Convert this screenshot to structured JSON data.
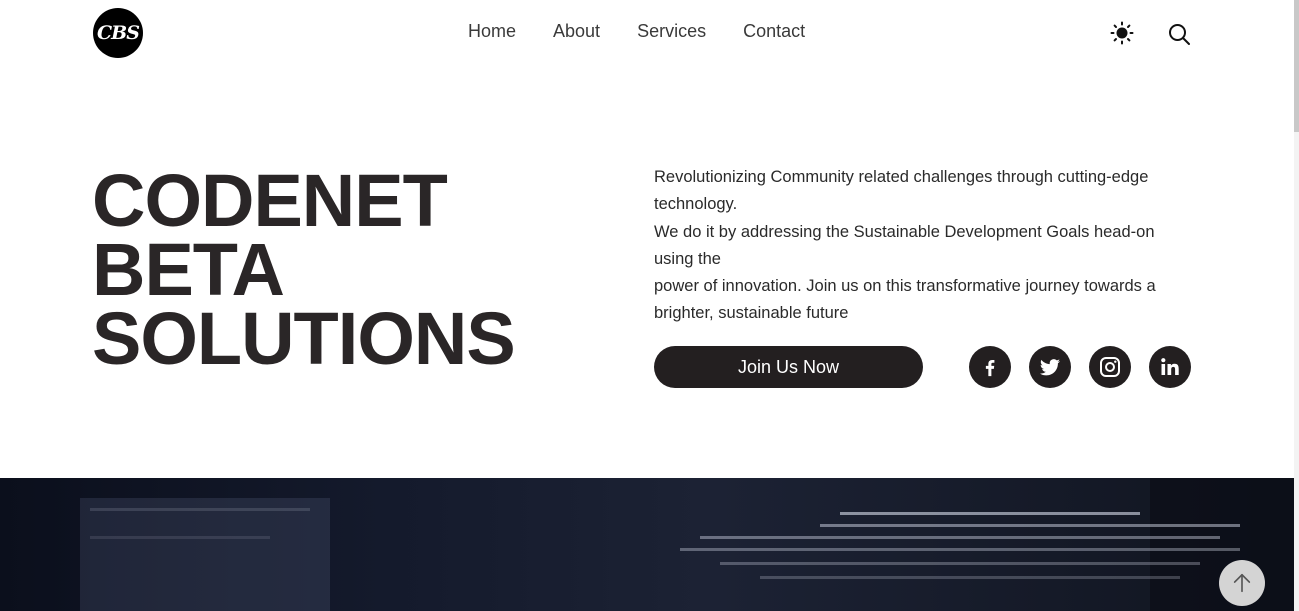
{
  "header": {
    "logo_text": "CBS",
    "nav": [
      "Home",
      "About",
      "Services",
      "Contact"
    ],
    "theme_icon": "sun-icon",
    "search_icon": "search-icon"
  },
  "hero": {
    "title_lines": [
      "CODENET",
      "BETA",
      "SOLUTIONS"
    ],
    "description_lines": [
      "Revolutionizing Community related challenges through cutting-edge technology.",
      "We do it by addressing the Sustainable Development Goals head-on using the",
      "power of innovation. Join us on this transformative journey towards a brighter, sustainable future"
    ],
    "cta_label": "Join Us Now",
    "social": [
      "facebook-icon",
      "twitter-icon",
      "instagram-icon",
      "linkedin-icon"
    ]
  },
  "back_to_top_icon": "arrow-up-icon",
  "colors": {
    "primary_dark": "#231f20",
    "background": "#ffffff",
    "banner_dark": "#0b0f1c"
  }
}
